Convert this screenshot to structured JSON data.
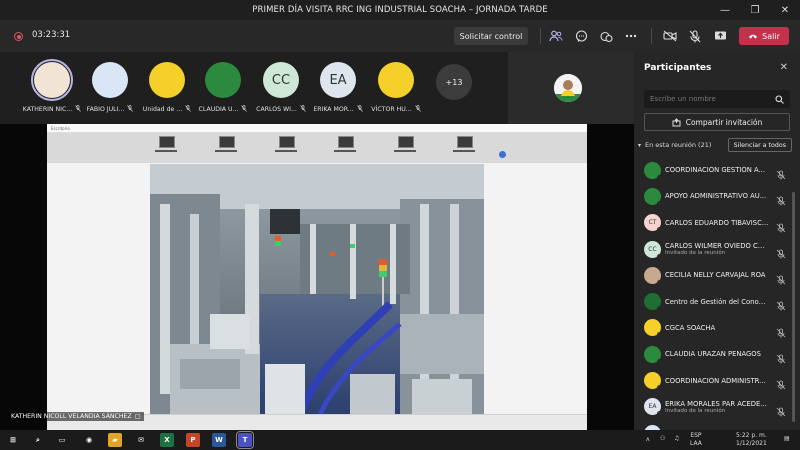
{
  "window": {
    "title": "PRIMER DÍA VISITA RRC ING INDUSTRIAL SOACHA – JORNADA TARDE",
    "minimize": "—",
    "restore": "❐",
    "close": "✕"
  },
  "toolbar": {
    "timer": "03:23:31",
    "control_label": "Solicitar control",
    "leave_label": "Salir"
  },
  "strip": {
    "participants": [
      {
        "name": "KATHERIN NIC...",
        "initials": "",
        "color": "#f1e4d4",
        "active": true
      },
      {
        "name": "FABIO JULI...",
        "initials": "",
        "color": "#d9e6f5",
        "active": false
      },
      {
        "name": "Unidad de ...",
        "initials": "",
        "color": "#f5cf2a",
        "active": false
      },
      {
        "name": "CLAUDIA U...",
        "initials": "",
        "color": "#2b8a3e",
        "active": false
      },
      {
        "name": "CARLOS WI...",
        "initials": "CC",
        "color": "#cfe7d6",
        "active": false
      },
      {
        "name": "ERIKA MOR...",
        "initials": "EA",
        "color": "#dfe5ee",
        "active": false
      },
      {
        "name": "VÍCTOR HU...",
        "initials": "",
        "color": "#f5cf2a",
        "active": false
      }
    ],
    "more_label": "+13"
  },
  "stage": {
    "share_header": "Escritorio",
    "presenter_label": "KATHERIN NICOLL VELANDIA SÁNCHEZ"
  },
  "panel": {
    "title": "Participantes",
    "search_placeholder": "Escribe un nombre",
    "invite_label": "Compartir invitación",
    "section_label": "En esta reunión (21)",
    "mute_all_label": "Silenciar a todos",
    "participants": [
      {
        "name": "COORDINACIÓN GESTIÓN A...",
        "sub": "",
        "initials": "",
        "color": "#2b8a3e"
      },
      {
        "name": "APOYO ADMINISTRATIVO AU...",
        "sub": "",
        "initials": "",
        "color": "#2b8a3e"
      },
      {
        "name": "CARLOS EDUARDO TIBAVISC...",
        "sub": "",
        "initials": "CT",
        "color": "#f6d3d0"
      },
      {
        "name": "CARLOS WILMER OVIEDO CO...",
        "sub": "Invitado de la reunión",
        "initials": "CC",
        "color": "#cfe7d6"
      },
      {
        "name": "CECILIA NELLY CARVAJAL ROA",
        "sub": "",
        "initials": "",
        "color": "#c9a98d"
      },
      {
        "name": "Centro de Gestión del Conoci...",
        "sub": "",
        "initials": "",
        "color": "#1f6e34"
      },
      {
        "name": "CGCA SOACHA",
        "sub": "",
        "initials": "",
        "color": "#f5cf2a"
      },
      {
        "name": "CLAUDIA URAZAN PENAGOS",
        "sub": "",
        "initials": "",
        "color": "#2b8a3e"
      },
      {
        "name": "COORDINACIÓN ADMINISTR...",
        "sub": "",
        "initials": "",
        "color": "#f5cf2a"
      },
      {
        "name": "ERIKA MORALES PAR ACEDE...",
        "sub": "Invitado de la reunión",
        "initials": "EA",
        "color": "#dfe5ee"
      },
      {
        "name": "FABIO JULIO GIL SANABRIA",
        "sub": "",
        "initials": "",
        "color": "#d9e6f5"
      }
    ]
  },
  "taskbar": {
    "lang1": "ESP",
    "lang2": "LAA",
    "time": "5:22 p. m.",
    "date": "1/12/2021",
    "apps": [
      {
        "label": "⊞",
        "color": "transparent"
      },
      {
        "label": "⌕",
        "color": "transparent"
      },
      {
        "label": "▭",
        "color": "transparent"
      },
      {
        "label": "◉",
        "color": "transparent"
      },
      {
        "label": "▰",
        "color": "#e0a526"
      },
      {
        "label": "✉",
        "color": "transparent"
      },
      {
        "label": "X",
        "color": "#1d7144"
      },
      {
        "label": "P",
        "color": "#c4462a"
      },
      {
        "label": "W",
        "color": "#2b5797"
      },
      {
        "label": "T",
        "color": "#4b53bc"
      }
    ]
  }
}
